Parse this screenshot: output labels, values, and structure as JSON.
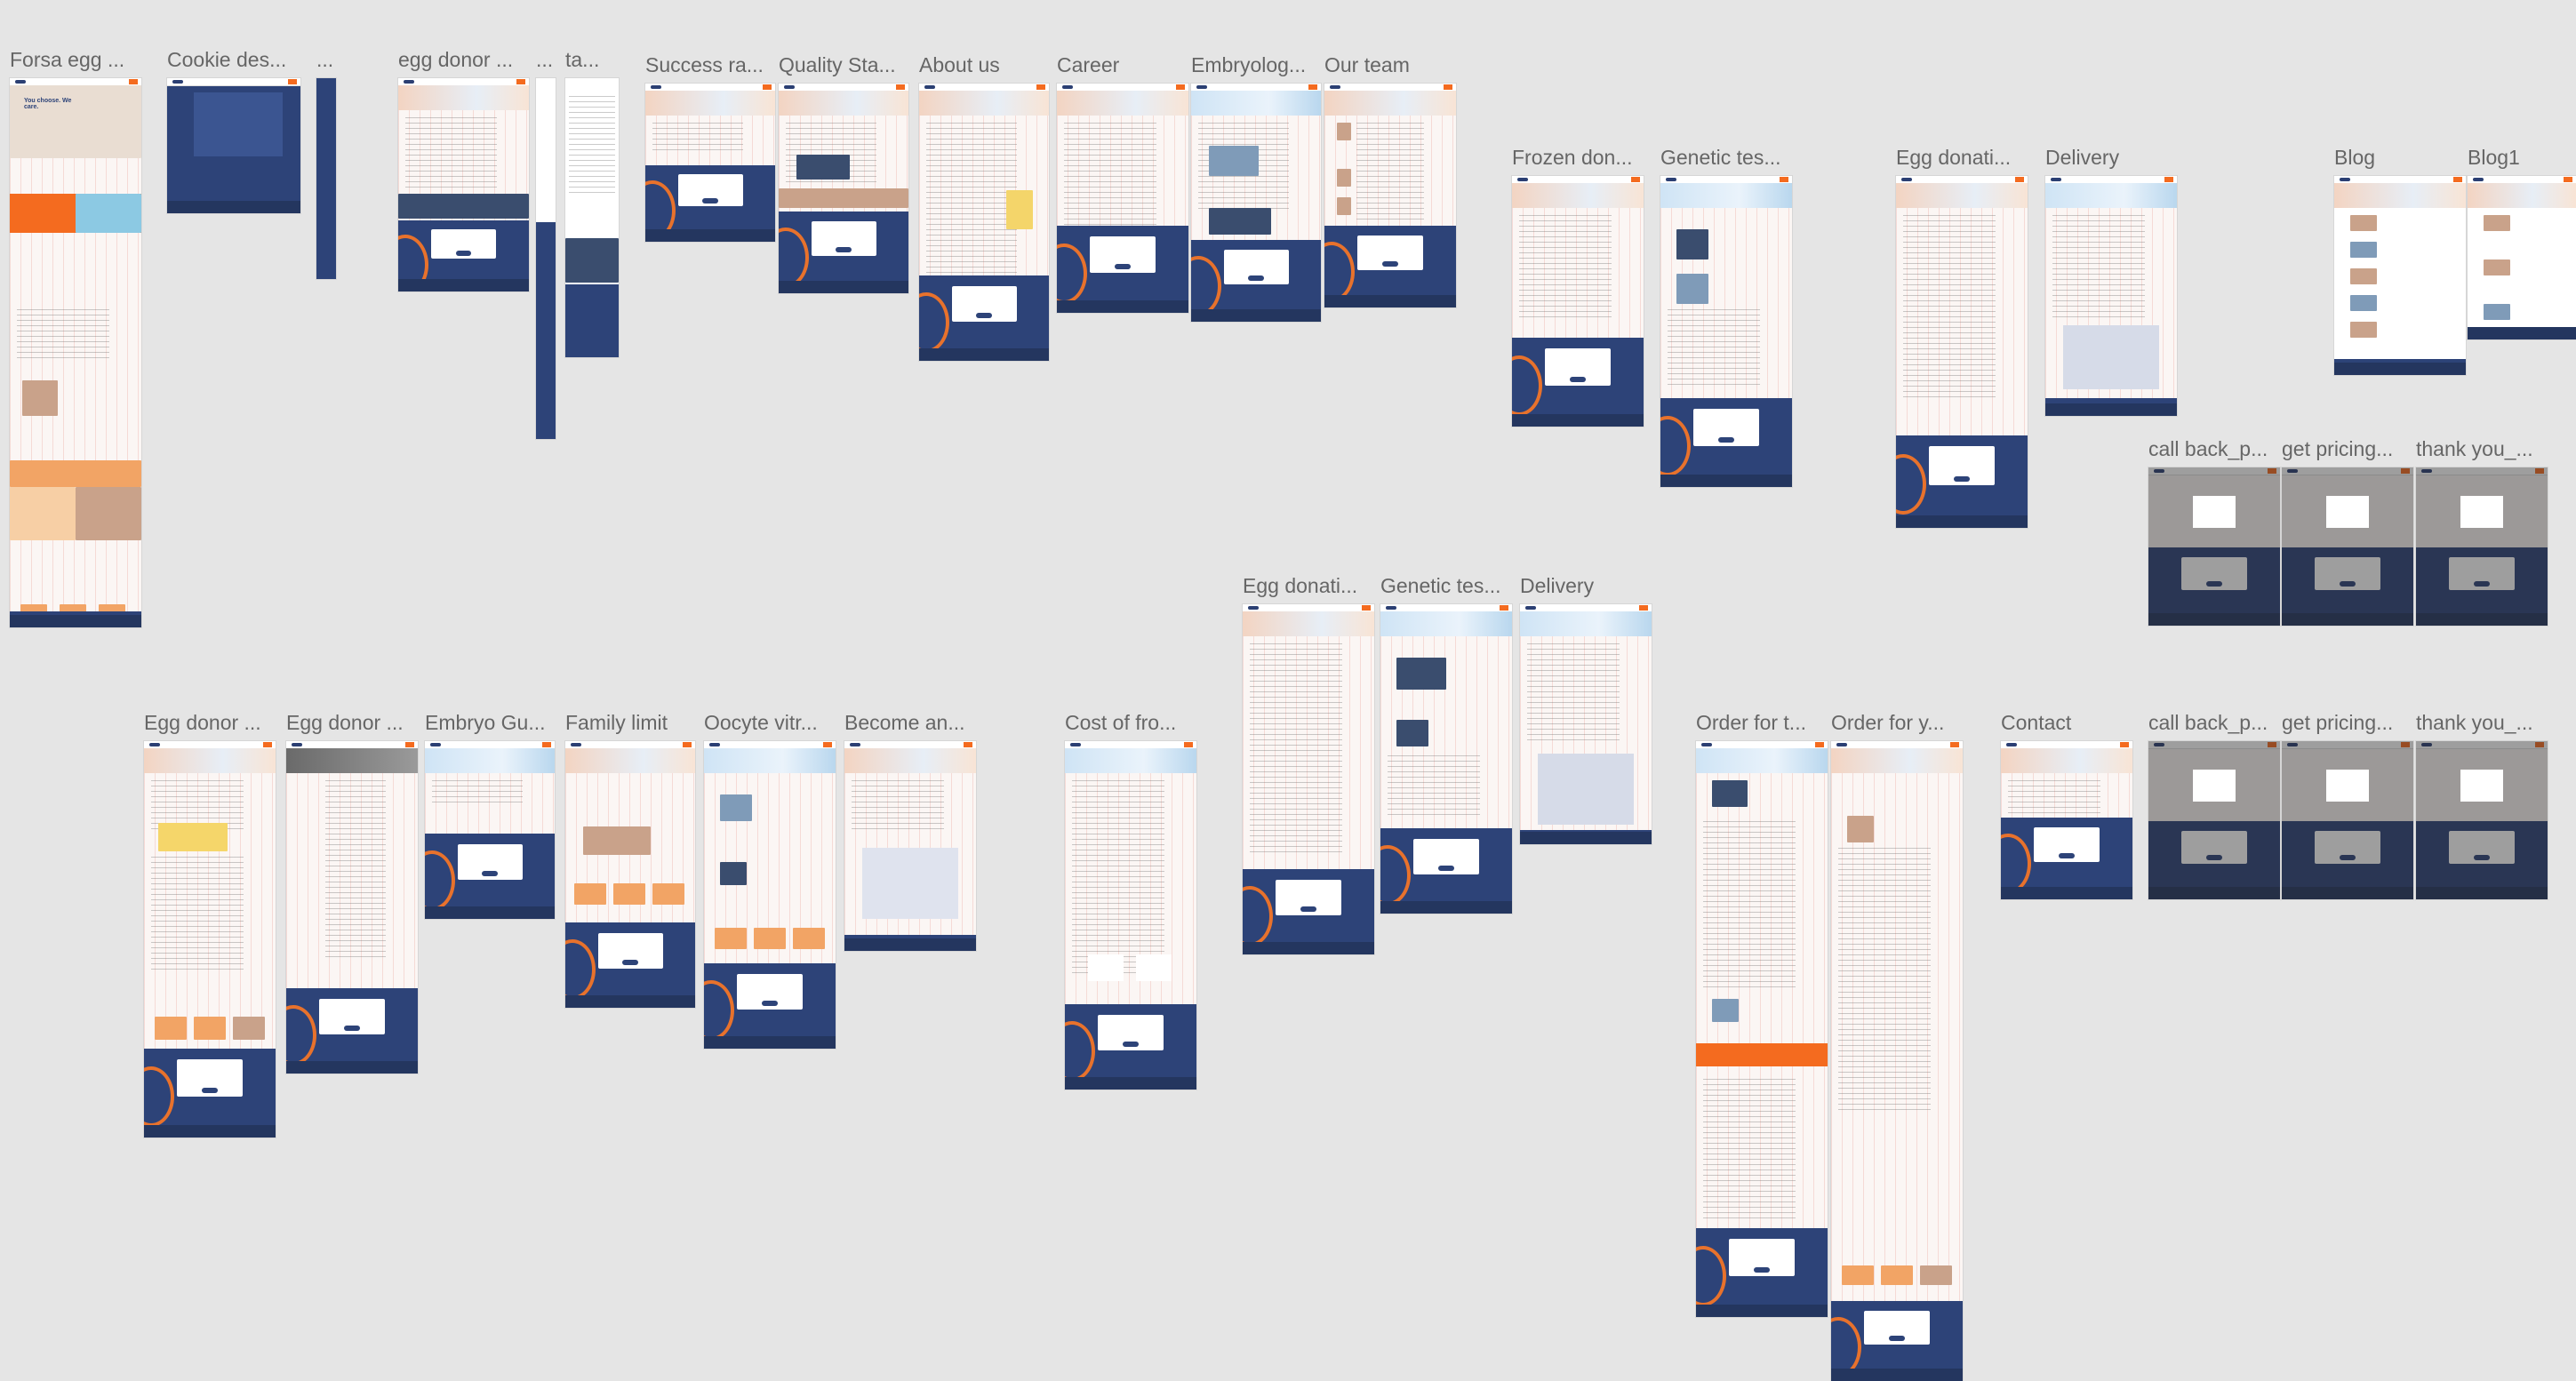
{
  "canvas": {
    "background": "#e5e5e5"
  },
  "frames": [
    {
      "id": "f1",
      "label": "Forsa egg ..."
    },
    {
      "id": "f2",
      "label": "Cookie des..."
    },
    {
      "id": "f3",
      "label": "..."
    },
    {
      "id": "f4",
      "label": "egg donor ..."
    },
    {
      "id": "f5",
      "label": "..."
    },
    {
      "id": "f6",
      "label": "ta..."
    },
    {
      "id": "f7",
      "label": "Success ra..."
    },
    {
      "id": "f8",
      "label": "Quality Sta..."
    },
    {
      "id": "f9",
      "label": "About us"
    },
    {
      "id": "f10",
      "label": "Career"
    },
    {
      "id": "f11",
      "label": "Embryolog..."
    },
    {
      "id": "f12",
      "label": "Our team"
    },
    {
      "id": "f13",
      "label": "Frozen don..."
    },
    {
      "id": "f14",
      "label": "Genetic tes..."
    },
    {
      "id": "f15",
      "label": "Egg donati..."
    },
    {
      "id": "f16",
      "label": "Delivery"
    },
    {
      "id": "f17",
      "label": "Blog"
    },
    {
      "id": "f18",
      "label": "Blog1"
    },
    {
      "id": "f19",
      "label": "call back_p..."
    },
    {
      "id": "f20",
      "label": "get pricing..."
    },
    {
      "id": "f21",
      "label": "thank you_..."
    },
    {
      "id": "f22",
      "label": "Egg donati..."
    },
    {
      "id": "f23",
      "label": "Genetic tes..."
    },
    {
      "id": "f24",
      "label": "Delivery"
    },
    {
      "id": "f25",
      "label": "Egg donor ..."
    },
    {
      "id": "f26",
      "label": "Egg donor ..."
    },
    {
      "id": "f27",
      "label": "Embryo Gu..."
    },
    {
      "id": "f28",
      "label": "Family limit"
    },
    {
      "id": "f29",
      "label": "Oocyte vitr..."
    },
    {
      "id": "f30",
      "label": "Become an..."
    },
    {
      "id": "f31",
      "label": "Cost of fro..."
    },
    {
      "id": "f32",
      "label": "Order for t..."
    },
    {
      "id": "f33",
      "label": "Order for y..."
    },
    {
      "id": "f34",
      "label": "Contact"
    },
    {
      "id": "f35",
      "label": "call back_p..."
    },
    {
      "id": "f36",
      "label": "get pricing..."
    },
    {
      "id": "f37",
      "label": "thank you_..."
    }
  ],
  "home_hero": {
    "headline": "You choose. We care."
  },
  "colors": {
    "brand_navy": "#2d4378",
    "brand_orange": "#f46b1f",
    "grid_pink": "#f0c4be"
  }
}
